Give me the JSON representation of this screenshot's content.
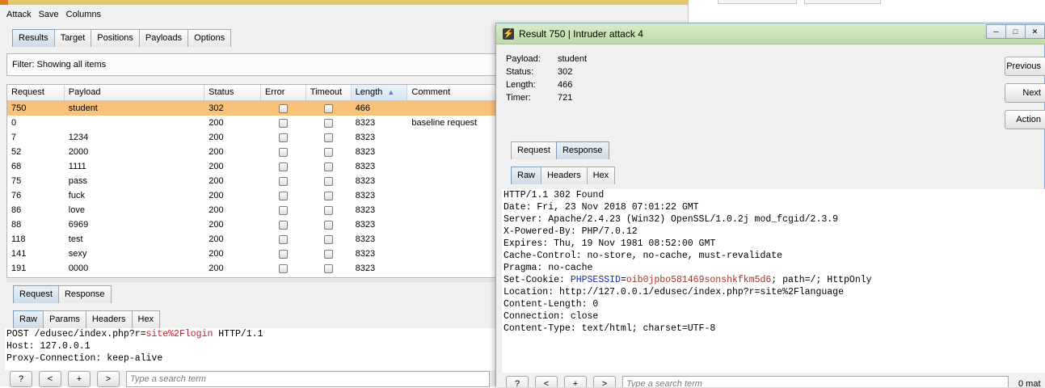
{
  "main_window": {
    "menu": [
      "Attack",
      "Save",
      "Columns"
    ],
    "tabs": [
      "Results",
      "Target",
      "Positions",
      "Payloads",
      "Options"
    ],
    "active_tab": "Results",
    "filter_text": "Filter: Showing all items",
    "table": {
      "columns": [
        "Request",
        "Payload",
        "Status",
        "Error",
        "Timeout",
        "Length",
        "Comment"
      ],
      "sorted_column": "Length",
      "rows": [
        {
          "request": "750",
          "payload": "student",
          "status": "302",
          "length": "466",
          "comment": "",
          "selected": true
        },
        {
          "request": "0",
          "payload": "",
          "status": "200",
          "length": "8323",
          "comment": "baseline request"
        },
        {
          "request": "7",
          "payload": "1234",
          "status": "200",
          "length": "8323",
          "comment": ""
        },
        {
          "request": "52",
          "payload": "2000",
          "status": "200",
          "length": "8323",
          "comment": ""
        },
        {
          "request": "68",
          "payload": "1111",
          "status": "200",
          "length": "8323",
          "comment": ""
        },
        {
          "request": "75",
          "payload": "pass",
          "status": "200",
          "length": "8323",
          "comment": ""
        },
        {
          "request": "76",
          "payload": "fuck",
          "status": "200",
          "length": "8323",
          "comment": ""
        },
        {
          "request": "86",
          "payload": "love",
          "status": "200",
          "length": "8323",
          "comment": ""
        },
        {
          "request": "88",
          "payload": "6969",
          "status": "200",
          "length": "8323",
          "comment": ""
        },
        {
          "request": "118",
          "payload": "test",
          "status": "200",
          "length": "8323",
          "comment": ""
        },
        {
          "request": "141",
          "payload": "sexy",
          "status": "200",
          "length": "8323",
          "comment": ""
        },
        {
          "request": "191",
          "payload": "0000",
          "status": "200",
          "length": "8323",
          "comment": ""
        }
      ]
    },
    "req_resp_tabs": [
      "Request",
      "Response"
    ],
    "req_resp_active": "Request",
    "view_tabs": [
      "Raw",
      "Params",
      "Headers",
      "Hex"
    ],
    "view_active": "Raw",
    "request_lines": [
      {
        "prefix": "POST /edusec/index.php?r=",
        "highlight": "site%2Flogin",
        "suffix": " HTTP/1.1"
      },
      {
        "prefix": "Host: 127.0.0.1",
        "highlight": "",
        "suffix": ""
      },
      {
        "prefix": "Proxy-Connection: keep-alive",
        "highlight": "",
        "suffix": ""
      }
    ],
    "search": {
      "buttons": [
        "?",
        "<",
        "+",
        ">"
      ],
      "placeholder": "Type a search term"
    }
  },
  "result_window": {
    "title": "Result 750 | Intruder attack 4",
    "info": [
      {
        "label": "Payload:",
        "value": "student"
      },
      {
        "label": "Status:",
        "value": "302"
      },
      {
        "label": "Length:",
        "value": "466"
      },
      {
        "label": "Timer:",
        "value": "721"
      }
    ],
    "side_buttons": [
      "Previous",
      "Next",
      "Action"
    ],
    "req_resp_tabs": [
      "Request",
      "Response"
    ],
    "req_resp_active": "Response",
    "view_tabs": [
      "Raw",
      "Headers",
      "Hex"
    ],
    "view_active": "Raw",
    "response_lines": [
      "HTTP/1.1 302 Found",
      "Date: Fri, 23 Nov 2018 07:01:22 GMT",
      "Server: Apache/2.4.23 (Win32) OpenSSL/1.0.2j mod_fcgid/2.3.9",
      "X-Powered-By: PHP/7.0.12",
      "Expires: Thu, 19 Nov 1981 08:52:00 GMT",
      "Cache-Control: no-store, no-cache, must-revalidate",
      "Pragma: no-cache",
      "Set-Cookie: ",
      "Location: http://127.0.0.1/edusec/index.php?r=site%2Flanguage",
      "Content-Length: 0",
      "Connection: close",
      "Content-Type: text/html; charset=UTF-8"
    ],
    "cookie": {
      "name": "PHPSESSID",
      "eq": "=",
      "value": "oib0jpbo581469sonshkfkm5d6",
      "rest": "; path=/; HttpOnly"
    },
    "search": {
      "buttons": [
        "?",
        "<",
        "+",
        ">"
      ],
      "placeholder": "Type a search term",
      "match_text": "0 mat"
    }
  },
  "colors": {
    "selected_row": "#f8c27a",
    "title_bar": "#c7e3b5",
    "highlight_red": "#c0202a"
  }
}
